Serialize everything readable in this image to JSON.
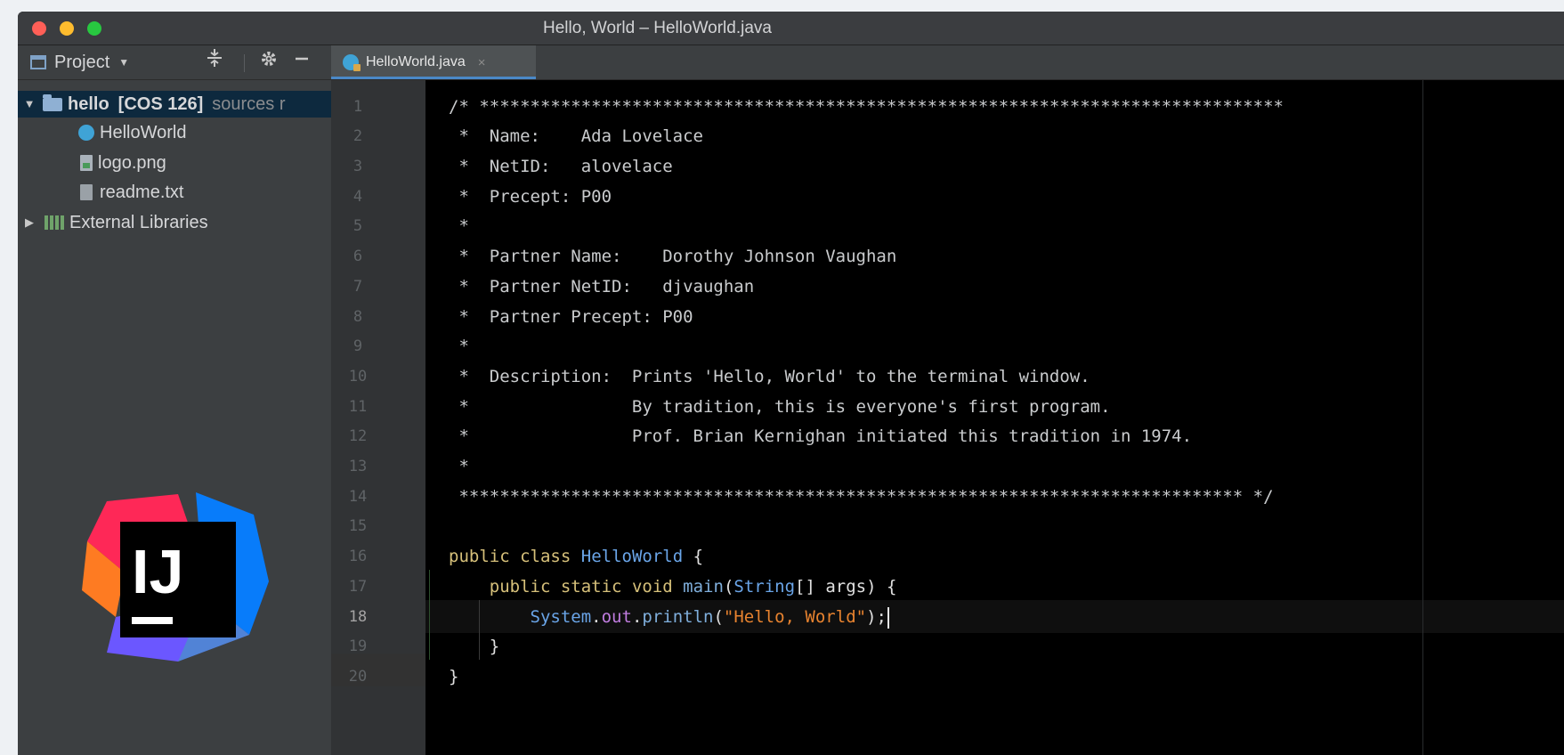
{
  "window": {
    "title": "Hello, World – HelloWorld.java"
  },
  "toolbar": {
    "project_label": "Project",
    "tab_label": "HelloWorld.java"
  },
  "sidebar": {
    "root": {
      "name": "hello",
      "module": "[COS 126]",
      "suffix": "sources r"
    },
    "files": [
      "HelloWorld",
      "logo.png",
      "readme.txt"
    ],
    "external": "External Libraries"
  },
  "logo": {
    "text": "IJ"
  },
  "editor": {
    "line_numbers": [
      "1",
      "2",
      "3",
      "4",
      "5",
      "6",
      "7",
      "8",
      "9",
      "10",
      "11",
      "12",
      "13",
      "14",
      "15",
      "16",
      "17",
      "18",
      "19",
      "20"
    ],
    "current_line": "18",
    "comment_lines": [
      "/* *******************************************************************************",
      " *  Name:    Ada Lovelace",
      " *  NetID:   alovelace",
      " *  Precept: P00",
      " *",
      " *  Partner Name:    Dorothy Johnson Vaughan",
      " *  Partner NetID:   djvaughan",
      " *  Partner Precept: P00",
      " *",
      " *  Description:  Prints 'Hello, World' to the terminal window.",
      " *                By tradition, this is everyone's first program.",
      " *                Prof. Brian Kernighan initiated this tradition in 1974.",
      " *",
      " ***************************************************************************** */",
      ""
    ],
    "code": {
      "l16_public": "public",
      "l16_class": "class",
      "l16_name": "HelloWorld",
      "l16_brace": "{",
      "l17_public": "public",
      "l17_static": "static",
      "l17_void": "void",
      "l17_main": "main",
      "l17_paren": "(",
      "l17_type": "String",
      "l17_rest": "[] args) {",
      "l18_system": "System",
      "l18_dot1": ".",
      "l18_out": "out",
      "l18_dot2": ".",
      "l18_println": "println",
      "l18_open": "(",
      "l18_string": "\"Hello, World\"",
      "l18_close": ");",
      "l19": "}",
      "l20": "}"
    }
  }
}
